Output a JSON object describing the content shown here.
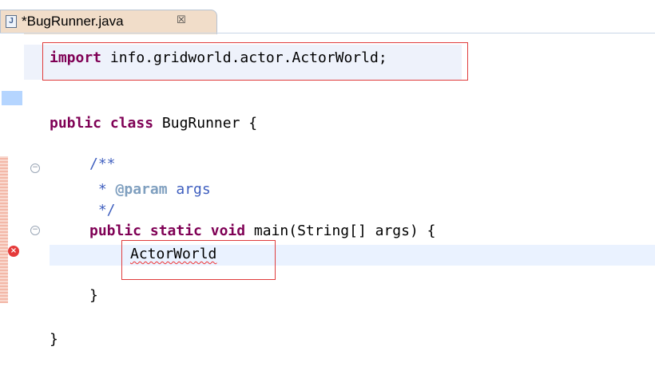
{
  "tab": {
    "title": "*BugRunner.java",
    "close_glyph": "☒",
    "file_icon": "java-file-icon"
  },
  "code": {
    "import_kw": "import",
    "import_path": " info.gridworld.actor.ActorWorld;",
    "class_kw1": "public",
    "class_kw2": " class",
    "class_name": " BugRunner {",
    "doc_open": "/**",
    "doc_param_prefix": " * ",
    "doc_param_tag": "@param",
    "doc_param_name": " args",
    "doc_close": " */",
    "main_kw1": "public",
    "main_kw2": " static",
    "main_kw3": " void",
    "main_sig": " main(String[] args) {",
    "error_token": "ActorWorld",
    "close_inner": "}",
    "close_outer": "}"
  },
  "colors": {
    "keyword": "#7f0055",
    "comment": "#3f5fbf",
    "annotation_box": "#e03c3c",
    "tab_active": "#f1ddc9"
  },
  "markers": {
    "fold_glyph": "−",
    "error_glyph": "×"
  }
}
